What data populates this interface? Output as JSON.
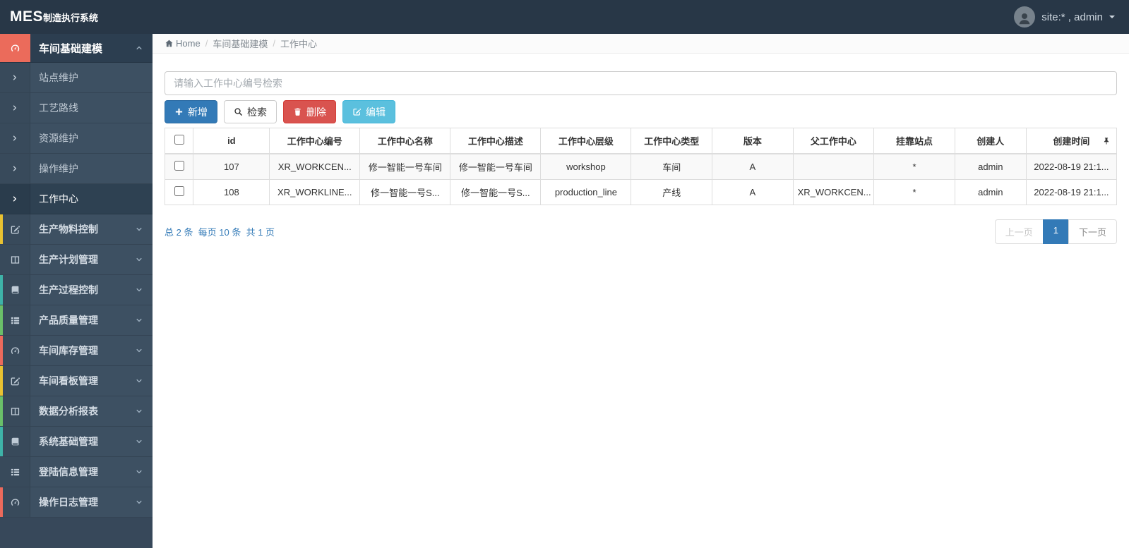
{
  "header": {
    "logo_primary": "MES",
    "logo_secondary": "制造执行系统",
    "user_label": "site:* , admin"
  },
  "sidebar": {
    "group_expanded": {
      "label": "车间基础建模",
      "icon": "gauge-icon",
      "icon_bg": "#eb6b5b"
    },
    "submenu": [
      {
        "label": "站点维护"
      },
      {
        "label": "工艺路线"
      },
      {
        "label": "资源维护"
      },
      {
        "label": "操作维护"
      },
      {
        "label": "工作中心"
      }
    ],
    "groups": [
      {
        "label": "生产物料控制",
        "icon": "pencil-square-icon",
        "accent": "#e9c231"
      },
      {
        "label": "生产计划管理",
        "icon": "columns-icon",
        "accent": "transparent"
      },
      {
        "label": "生产过程控制",
        "icon": "book-icon",
        "accent": "#3eb3a8"
      },
      {
        "label": "产品质量管理",
        "icon": "th-list-icon",
        "accent": "#6abf69"
      },
      {
        "label": "车间库存管理",
        "icon": "gauge-icon",
        "accent": "#ec6a5c"
      },
      {
        "label": "车间看板管理",
        "icon": "pencil-square-icon",
        "accent": "#e9c231"
      },
      {
        "label": "数据分析报表",
        "icon": "columns-icon",
        "accent": "#6abf69"
      },
      {
        "label": "系统基础管理",
        "icon": "book-icon",
        "accent": "#3eb3a8"
      },
      {
        "label": "登陆信息管理",
        "icon": "th-list-icon",
        "accent": "transparent"
      },
      {
        "label": "操作日志管理",
        "icon": "gauge-icon",
        "accent": "#ec6a5c"
      }
    ]
  },
  "breadcrumb": {
    "home": "Home",
    "section": "车间基础建模",
    "current": "工作中心"
  },
  "toolbar": {
    "search_placeholder": "请输入工作中心编号检索",
    "add_label": "新增",
    "search_label": "检索",
    "delete_label": "删除",
    "edit_label": "编辑"
  },
  "table": {
    "columns": [
      "id",
      "工作中心编号",
      "工作中心名称",
      "工作中心描述",
      "工作中心层级",
      "工作中心类型",
      "版本",
      "父工作中心",
      "挂靠站点",
      "创建人",
      "创建时间"
    ],
    "rows": [
      [
        "107",
        "XR_WORKCEN...",
        "修一智能一号车间",
        "修一智能一号车间",
        "workshop",
        "车间",
        "A",
        "",
        "*",
        "admin",
        "2022-08-19 21:1..."
      ],
      [
        "108",
        "XR_WORKLINE...",
        "修一智能一号S...",
        "修一智能一号S...",
        "production_line",
        "产线",
        "A",
        "XR_WORKCEN...",
        "*",
        "admin",
        "2022-08-19 21:1..."
      ]
    ]
  },
  "pagination": {
    "summary": "总 2 条  每页 10 条  共 1 页",
    "prev_label": "上一页",
    "current_page": "1",
    "next_label": "下一页"
  },
  "colors": {
    "primary_button": "#337ab7",
    "danger_button": "#d9534f",
    "info_button": "#5bc0de",
    "sidebar_active_icon_bg": "#eb6b5b",
    "pagination_active": "#337ab7"
  }
}
